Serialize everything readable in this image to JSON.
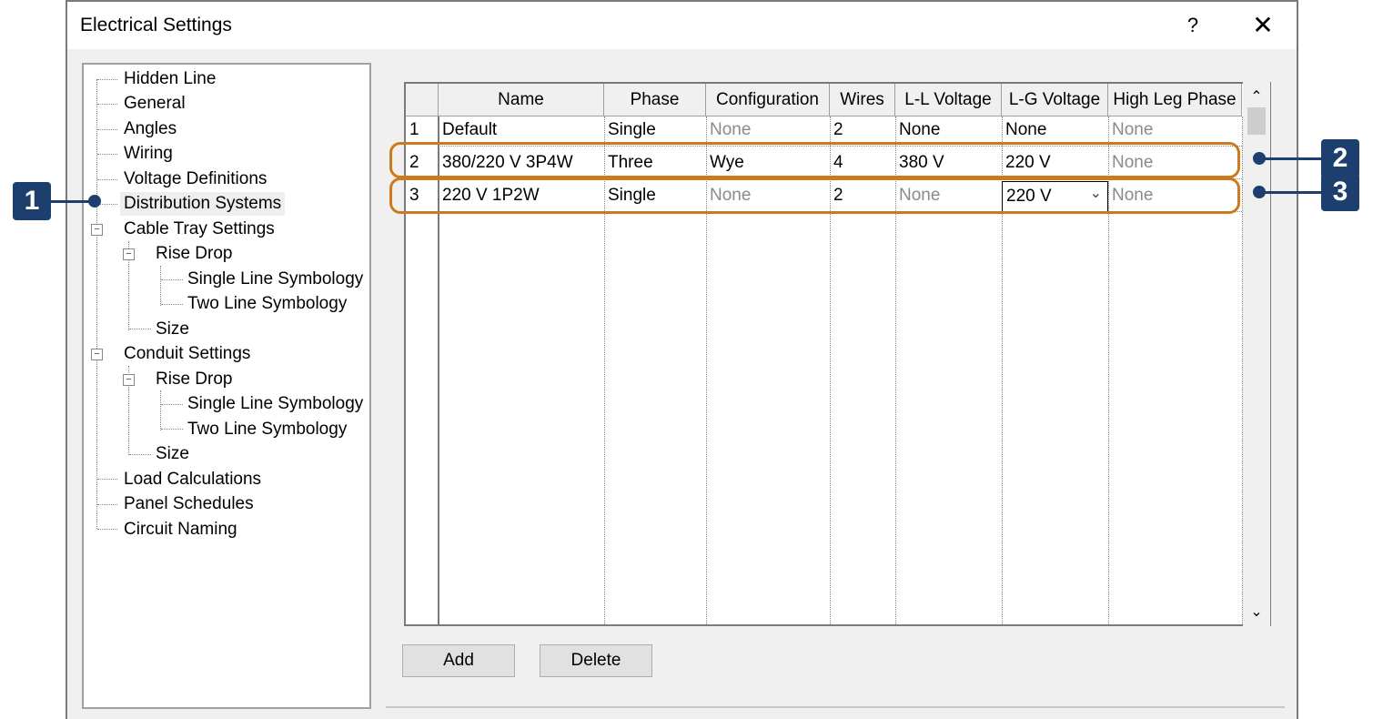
{
  "window": {
    "title": "Electrical Settings",
    "help_label": "?",
    "close_label": "✕"
  },
  "tree": {
    "items": [
      {
        "label": "Hidden Line"
      },
      {
        "label": "General"
      },
      {
        "label": "Angles"
      },
      {
        "label": "Wiring"
      },
      {
        "label": "Voltage Definitions"
      },
      {
        "label": "Distribution Systems",
        "selected": true
      },
      {
        "label": "Cable Tray Settings",
        "expanded": true
      },
      {
        "label": "Rise Drop",
        "expanded": true
      },
      {
        "label": "Single Line Symbology"
      },
      {
        "label": "Two Line Symbology"
      },
      {
        "label": "Size"
      },
      {
        "label": "Conduit Settings",
        "expanded": true
      },
      {
        "label": "Rise Drop",
        "expanded": true
      },
      {
        "label": "Single Line Symbology"
      },
      {
        "label": "Two Line Symbology"
      },
      {
        "label": "Size"
      },
      {
        "label": "Load Calculations"
      },
      {
        "label": "Panel Schedules"
      },
      {
        "label": "Circuit Naming"
      }
    ],
    "expander_symbol": "−"
  },
  "table": {
    "columns": [
      "Name",
      "Phase",
      "Configuration",
      "Wires",
      "L-L Voltage",
      "L-G Voltage",
      "High Leg Phase"
    ],
    "rows": [
      {
        "num": "1",
        "name": "Default",
        "phase": "Single",
        "configuration": "None",
        "wires": "2",
        "ll_voltage": "None",
        "lg_voltage": "None",
        "high_leg": "None"
      },
      {
        "num": "2",
        "name": "380/220 V 3P4W",
        "phase": "Three",
        "configuration": "Wye",
        "wires": "4",
        "ll_voltage": "380 V",
        "lg_voltage": "220 V",
        "high_leg": "None"
      },
      {
        "num": "3",
        "name": "220 V 1P2W",
        "phase": "Single",
        "configuration": "None",
        "wires": "2",
        "ll_voltage": "None",
        "lg_voltage": "220 V",
        "high_leg": "None"
      }
    ],
    "dropdown_arrow": "⌄"
  },
  "scrollbar": {
    "up_icon": "⌃",
    "down_icon": "⌄"
  },
  "buttons": {
    "add": "Add",
    "delete": "Delete"
  },
  "callouts": [
    {
      "label": "1"
    },
    {
      "label": "2"
    },
    {
      "label": "3"
    }
  ],
  "colors": {
    "callout": "#1c3f6e",
    "highlight": "#cc7a20"
  }
}
